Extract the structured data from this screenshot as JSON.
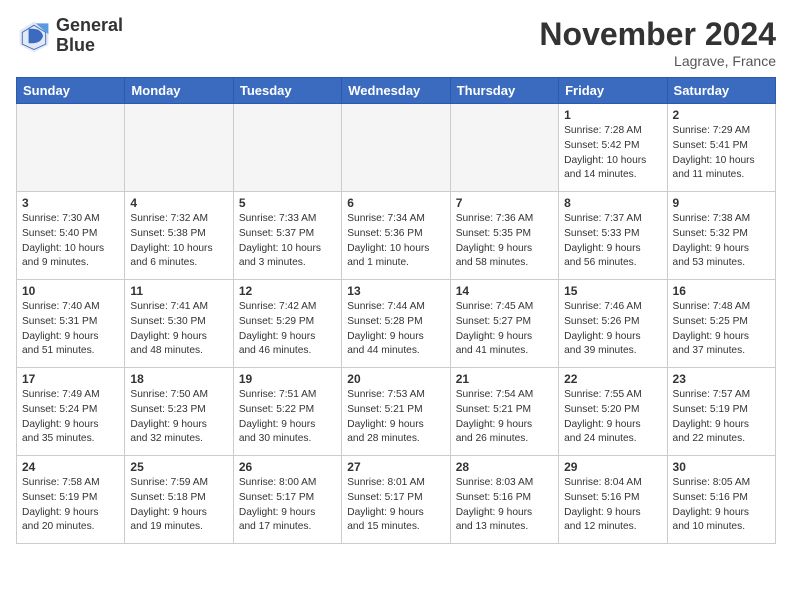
{
  "header": {
    "logo_line1": "General",
    "logo_line2": "Blue",
    "month": "November 2024",
    "location": "Lagrave, France"
  },
  "weekdays": [
    "Sunday",
    "Monday",
    "Tuesday",
    "Wednesday",
    "Thursday",
    "Friday",
    "Saturday"
  ],
  "weeks": [
    [
      {
        "day": "",
        "info": ""
      },
      {
        "day": "",
        "info": ""
      },
      {
        "day": "",
        "info": ""
      },
      {
        "day": "",
        "info": ""
      },
      {
        "day": "",
        "info": ""
      },
      {
        "day": "1",
        "info": "Sunrise: 7:28 AM\nSunset: 5:42 PM\nDaylight: 10 hours\nand 14 minutes."
      },
      {
        "day": "2",
        "info": "Sunrise: 7:29 AM\nSunset: 5:41 PM\nDaylight: 10 hours\nand 11 minutes."
      }
    ],
    [
      {
        "day": "3",
        "info": "Sunrise: 7:30 AM\nSunset: 5:40 PM\nDaylight: 10 hours\nand 9 minutes."
      },
      {
        "day": "4",
        "info": "Sunrise: 7:32 AM\nSunset: 5:38 PM\nDaylight: 10 hours\nand 6 minutes."
      },
      {
        "day": "5",
        "info": "Sunrise: 7:33 AM\nSunset: 5:37 PM\nDaylight: 10 hours\nand 3 minutes."
      },
      {
        "day": "6",
        "info": "Sunrise: 7:34 AM\nSunset: 5:36 PM\nDaylight: 10 hours\nand 1 minute."
      },
      {
        "day": "7",
        "info": "Sunrise: 7:36 AM\nSunset: 5:35 PM\nDaylight: 9 hours\nand 58 minutes."
      },
      {
        "day": "8",
        "info": "Sunrise: 7:37 AM\nSunset: 5:33 PM\nDaylight: 9 hours\nand 56 minutes."
      },
      {
        "day": "9",
        "info": "Sunrise: 7:38 AM\nSunset: 5:32 PM\nDaylight: 9 hours\nand 53 minutes."
      }
    ],
    [
      {
        "day": "10",
        "info": "Sunrise: 7:40 AM\nSunset: 5:31 PM\nDaylight: 9 hours\nand 51 minutes."
      },
      {
        "day": "11",
        "info": "Sunrise: 7:41 AM\nSunset: 5:30 PM\nDaylight: 9 hours\nand 48 minutes."
      },
      {
        "day": "12",
        "info": "Sunrise: 7:42 AM\nSunset: 5:29 PM\nDaylight: 9 hours\nand 46 minutes."
      },
      {
        "day": "13",
        "info": "Sunrise: 7:44 AM\nSunset: 5:28 PM\nDaylight: 9 hours\nand 44 minutes."
      },
      {
        "day": "14",
        "info": "Sunrise: 7:45 AM\nSunset: 5:27 PM\nDaylight: 9 hours\nand 41 minutes."
      },
      {
        "day": "15",
        "info": "Sunrise: 7:46 AM\nSunset: 5:26 PM\nDaylight: 9 hours\nand 39 minutes."
      },
      {
        "day": "16",
        "info": "Sunrise: 7:48 AM\nSunset: 5:25 PM\nDaylight: 9 hours\nand 37 minutes."
      }
    ],
    [
      {
        "day": "17",
        "info": "Sunrise: 7:49 AM\nSunset: 5:24 PM\nDaylight: 9 hours\nand 35 minutes."
      },
      {
        "day": "18",
        "info": "Sunrise: 7:50 AM\nSunset: 5:23 PM\nDaylight: 9 hours\nand 32 minutes."
      },
      {
        "day": "19",
        "info": "Sunrise: 7:51 AM\nSunset: 5:22 PM\nDaylight: 9 hours\nand 30 minutes."
      },
      {
        "day": "20",
        "info": "Sunrise: 7:53 AM\nSunset: 5:21 PM\nDaylight: 9 hours\nand 28 minutes."
      },
      {
        "day": "21",
        "info": "Sunrise: 7:54 AM\nSunset: 5:21 PM\nDaylight: 9 hours\nand 26 minutes."
      },
      {
        "day": "22",
        "info": "Sunrise: 7:55 AM\nSunset: 5:20 PM\nDaylight: 9 hours\nand 24 minutes."
      },
      {
        "day": "23",
        "info": "Sunrise: 7:57 AM\nSunset: 5:19 PM\nDaylight: 9 hours\nand 22 minutes."
      }
    ],
    [
      {
        "day": "24",
        "info": "Sunrise: 7:58 AM\nSunset: 5:19 PM\nDaylight: 9 hours\nand 20 minutes."
      },
      {
        "day": "25",
        "info": "Sunrise: 7:59 AM\nSunset: 5:18 PM\nDaylight: 9 hours\nand 19 minutes."
      },
      {
        "day": "26",
        "info": "Sunrise: 8:00 AM\nSunset: 5:17 PM\nDaylight: 9 hours\nand 17 minutes."
      },
      {
        "day": "27",
        "info": "Sunrise: 8:01 AM\nSunset: 5:17 PM\nDaylight: 9 hours\nand 15 minutes."
      },
      {
        "day": "28",
        "info": "Sunrise: 8:03 AM\nSunset: 5:16 PM\nDaylight: 9 hours\nand 13 minutes."
      },
      {
        "day": "29",
        "info": "Sunrise: 8:04 AM\nSunset: 5:16 PM\nDaylight: 9 hours\nand 12 minutes."
      },
      {
        "day": "30",
        "info": "Sunrise: 8:05 AM\nSunset: 5:16 PM\nDaylight: 9 hours\nand 10 minutes."
      }
    ]
  ]
}
